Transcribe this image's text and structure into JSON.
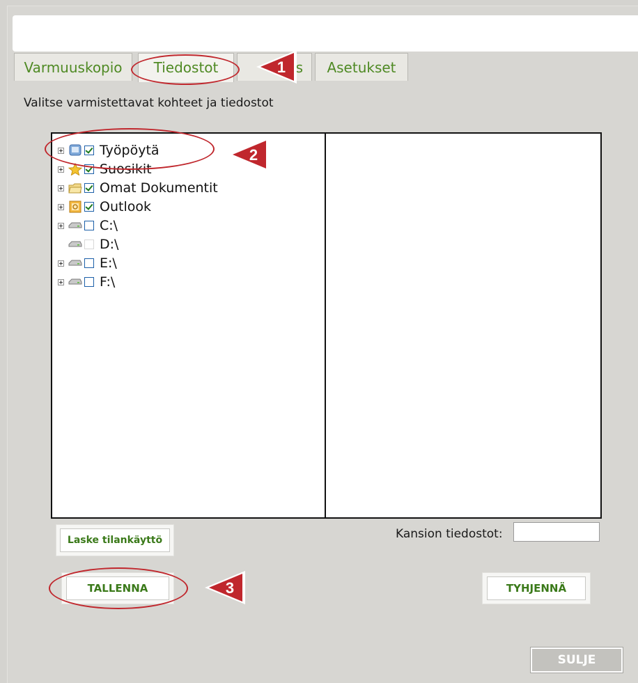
{
  "tabs": [
    {
      "label": "Varmuuskopio"
    },
    {
      "label": "Tiedostot"
    },
    {
      "label": "s"
    },
    {
      "label": "Asetukset"
    }
  ],
  "instruction": "Valitse varmistettavat kohteet ja tiedostot",
  "tree": [
    {
      "label": "Työpöytä",
      "checked": true,
      "expandable": true,
      "icon": "desktop-icon"
    },
    {
      "label": "Suosikit",
      "checked": true,
      "expandable": true,
      "icon": "star-icon"
    },
    {
      "label": "Omat Dokumentit",
      "checked": true,
      "expandable": true,
      "icon": "folder-icon"
    },
    {
      "label": "Outlook",
      "checked": true,
      "expandable": true,
      "icon": "outlook-icon"
    },
    {
      "label": "C:\\",
      "checked": false,
      "expandable": true,
      "icon": "drive-icon"
    },
    {
      "label": "D:\\",
      "checked": false,
      "expandable": false,
      "icon": "drive-icon"
    },
    {
      "label": "E:\\",
      "checked": false,
      "expandable": true,
      "icon": "drive-icon"
    },
    {
      "label": "F:\\",
      "checked": false,
      "expandable": true,
      "icon": "drive-icon"
    }
  ],
  "buttons": {
    "laske": "Laske tilankäyttö",
    "tallenna": "TALLENNA",
    "tyhjenna": "TYHJENNÄ",
    "sulje": "SULJE"
  },
  "kansion": {
    "label": "Kansion tiedostot:",
    "value": ""
  },
  "markers": [
    "1",
    "2",
    "3"
  ],
  "colors": {
    "accent_green": "#4f8a24",
    "annotation_red": "#c0272d"
  }
}
